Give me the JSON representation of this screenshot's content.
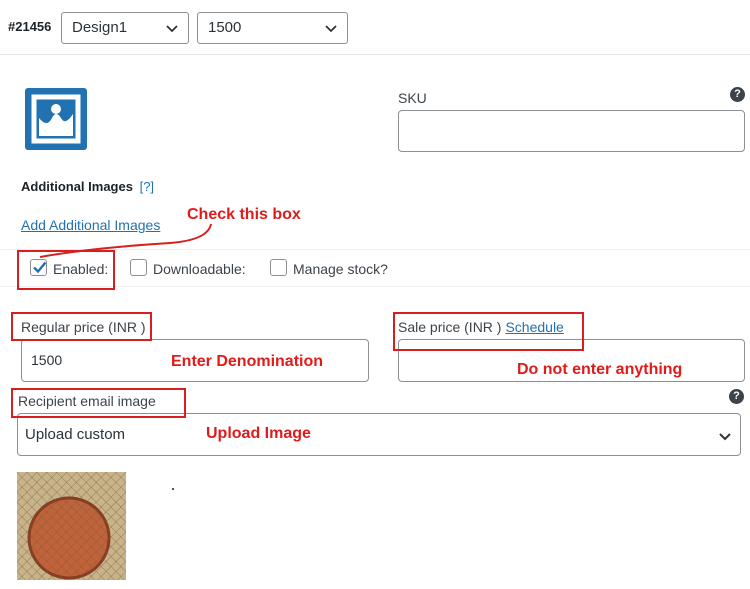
{
  "header": {
    "variation_id": "#21456",
    "design_select": {
      "value": "Design1"
    },
    "amount_select": {
      "value": "1500"
    }
  },
  "fields": {
    "sku_label": "SKU",
    "additional_images_title": "Additional Images",
    "additional_images_help": "[?]",
    "add_additional_images_link": "Add Additional Images",
    "options": [
      {
        "label": "Enabled:",
        "checked": true
      },
      {
        "label": "Downloadable:",
        "checked": false
      },
      {
        "label": "Manage stock?",
        "checked": false
      }
    ],
    "regular_price_label": "Regular price (INR )",
    "regular_price_value": "1500",
    "sale_price_label": "Sale price (INR )",
    "schedule_link": "Schedule",
    "recipient_email_image_label": "Recipient email image",
    "upload_select_value": "Upload custom"
  },
  "annotations": {
    "check_box": "Check this box",
    "enter_denomination": "Enter Denomination",
    "do_not_enter": "Do not enter anything",
    "upload_image": "Upload Image"
  },
  "colors": {
    "accent": "#2271b1",
    "annotation": "#d81e1e"
  }
}
